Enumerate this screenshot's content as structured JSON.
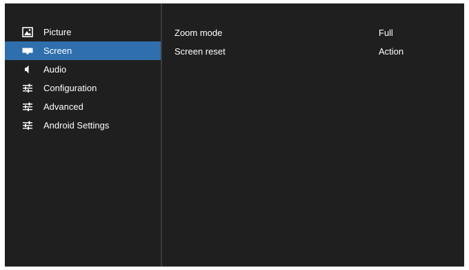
{
  "sidebar": {
    "items": [
      {
        "label": "Picture",
        "icon": "picture-icon",
        "selected": false
      },
      {
        "label": "Screen",
        "icon": "screen-icon",
        "selected": true
      },
      {
        "label": "Audio",
        "icon": "speaker-icon",
        "selected": false
      },
      {
        "label": "Configuration",
        "icon": "sliders-icon",
        "selected": false
      },
      {
        "label": "Advanced",
        "icon": "sliders-icon",
        "selected": false
      },
      {
        "label": "Android Settings",
        "icon": "sliders-icon",
        "selected": false
      }
    ]
  },
  "settings": {
    "rows": [
      {
        "name": "Zoom mode",
        "value": "Full"
      },
      {
        "name": "Screen reset",
        "value": "Action"
      }
    ]
  },
  "colors": {
    "background": "#1f1f1f",
    "selected": "#2f6fae",
    "divider": "#3c3c3c",
    "text": "#ffffff"
  }
}
